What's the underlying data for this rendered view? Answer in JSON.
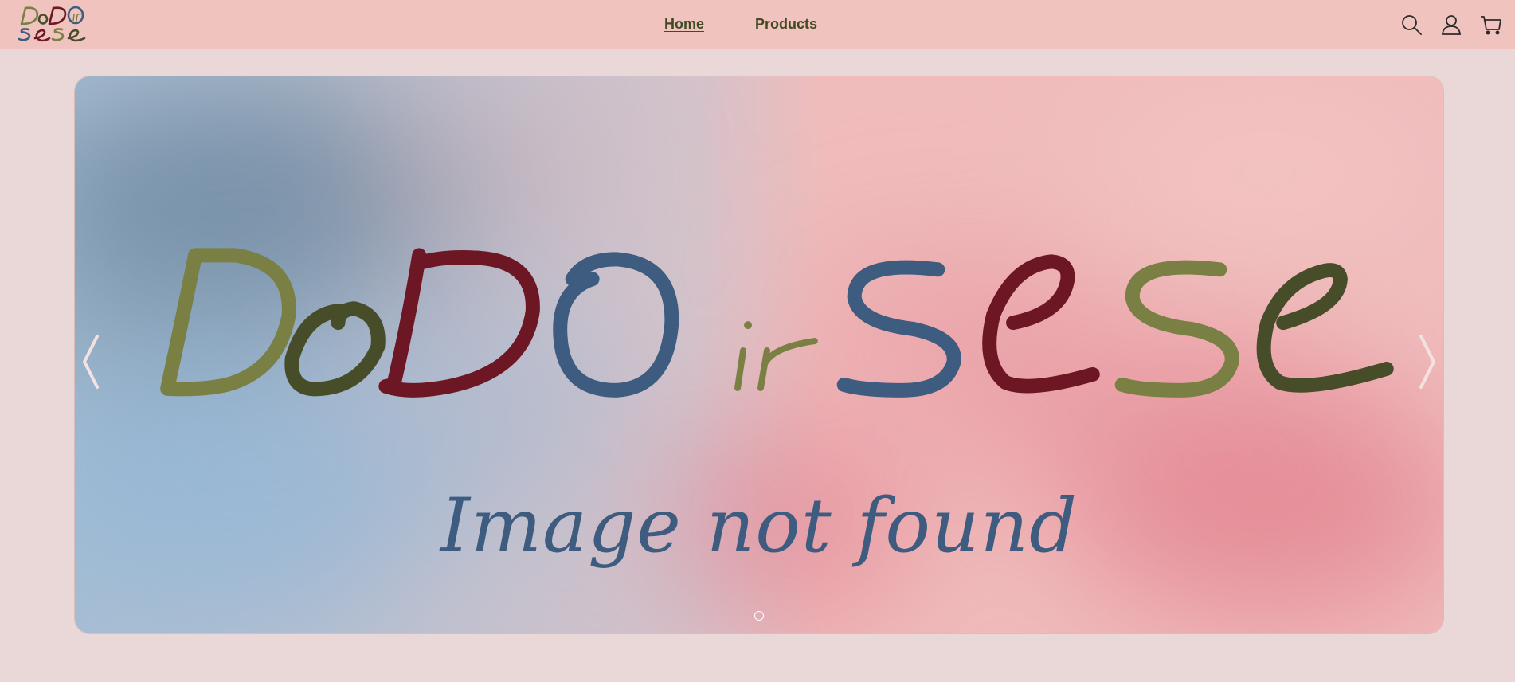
{
  "brand": {
    "logo_name": "DoDO ir sese",
    "colors": {
      "olive": "#7a8044",
      "dark_olive": "#464d28",
      "burgundy": "#6e1724",
      "slate_blue": "#3d5c7f",
      "header_bg": "#f0c3bf",
      "page_bg": "#ead8d8",
      "nav_text": "#414a23"
    }
  },
  "nav": {
    "items": [
      {
        "label": "Home",
        "active": true
      },
      {
        "label": "Products",
        "active": false
      }
    ]
  },
  "header_icons": [
    "search-icon",
    "account-icon",
    "cart-icon"
  ],
  "carousel": {
    "hero_wordmark": "DoDO ir sese",
    "placeholder_text": "Image not found",
    "slide_count": 1,
    "active_slide": 1,
    "prev_icon": "chevron-left-icon",
    "next_icon": "chevron-right-icon"
  }
}
